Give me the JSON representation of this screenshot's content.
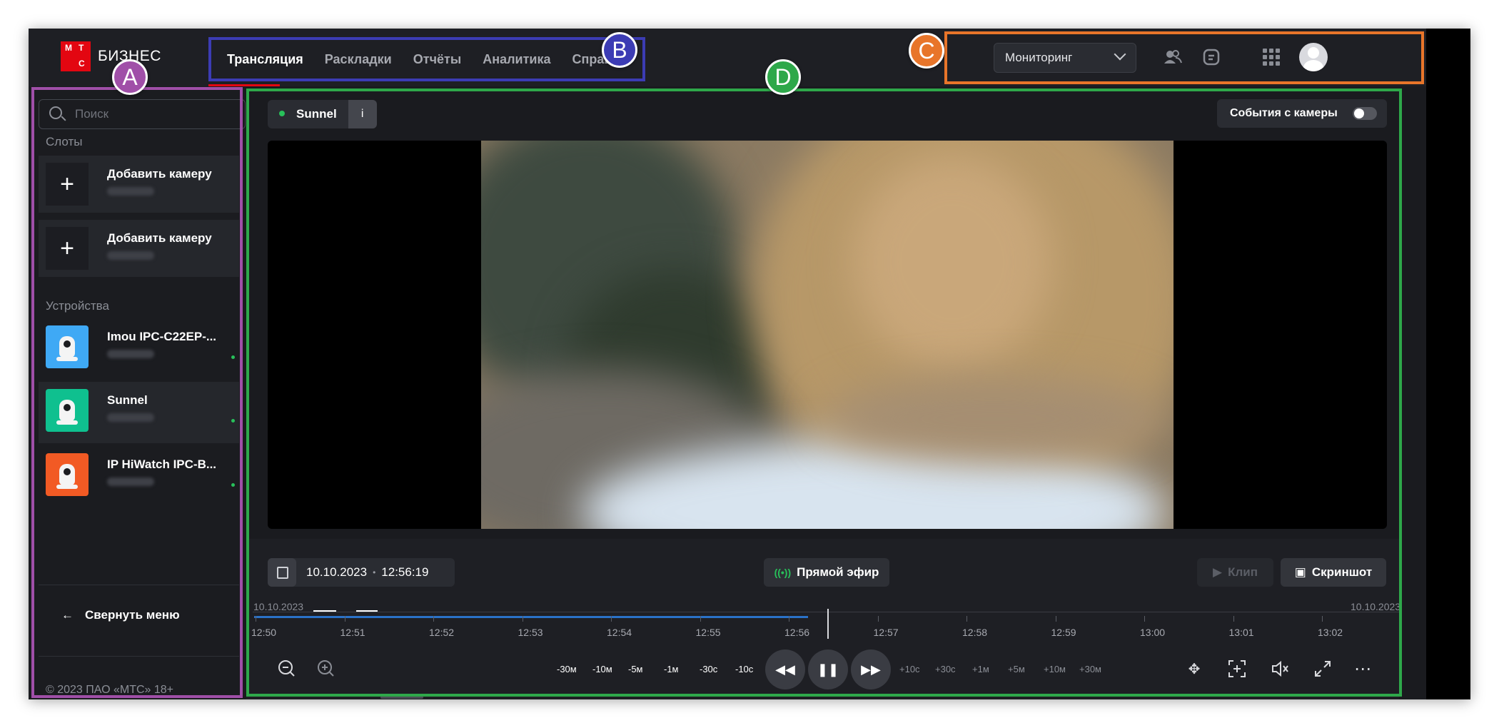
{
  "logo": {
    "brand": "БИЗНЕС",
    "mark_letters": [
      "М",
      "Т",
      "С"
    ]
  },
  "nav": {
    "items": [
      {
        "label": "Трансляция",
        "active": true
      },
      {
        "label": "Раскладки",
        "active": false
      },
      {
        "label": "Отчёты",
        "active": false
      },
      {
        "label": "Аналитика",
        "active": false
      },
      {
        "label": "Справка",
        "active": false
      }
    ]
  },
  "header_right": {
    "dropdown_value": "Мониторинг",
    "icons": [
      "users-icon",
      "chat-icon",
      "apps-grid-icon",
      "avatar"
    ]
  },
  "sidebar": {
    "search_placeholder": "Поиск",
    "slots_label": "Слоты",
    "slots": [
      {
        "title": "Добавить камеру"
      },
      {
        "title": "Добавить камеру"
      }
    ],
    "devices_label": "Устройства",
    "devices": [
      {
        "title": "Imou IPC-C22EP-...",
        "color": "#3fa9f5",
        "active": false
      },
      {
        "title": "Sunnel",
        "color": "#0fc08f",
        "active": true
      },
      {
        "title": "IP HiWatch IPC-B...",
        "color": "#f25a24",
        "active": false
      }
    ],
    "collapse_label": "Свернуть меню",
    "copyright": "© 2023 ПАО «МТС» 18+"
  },
  "player": {
    "camera_name": "Sunnel",
    "info_label": "i",
    "events_toggle_label": "События с камеры",
    "events_toggle_on": false,
    "date": "10.10.2023",
    "separator": "•",
    "time": "12:56:19",
    "live_label": "Прямой эфир",
    "clip_label": "Клип",
    "screenshot_label": "Скриншот"
  },
  "timeline": {
    "start_date": "10.10.2023",
    "end_date": "10.10.2023",
    "labels": [
      "12:50",
      "12:51",
      "12:52",
      "12:53",
      "12:54",
      "12:55",
      "12:56",
      "12:57",
      "12:58",
      "12:59",
      "13:00",
      "13:01",
      "13:02"
    ]
  },
  "controls": {
    "rewind": [
      "-30м",
      "-10м",
      "-5м",
      "-1м",
      "-30с",
      "-10с"
    ],
    "forward": [
      "+10с",
      "+30с",
      "+1м",
      "+5м",
      "+10м",
      "+30м"
    ]
  },
  "annotations": {
    "A": "A",
    "B": "B",
    "C": "C",
    "D": "D"
  },
  "colors": {
    "accent_red": "#e30611",
    "live_green": "#28c05a",
    "timeline_blue": "#2a72c8",
    "frame_A": "#a04fa8",
    "frame_B": "#3c3cb4",
    "frame_C": "#e8752a",
    "frame_D": "#2ea84a"
  }
}
